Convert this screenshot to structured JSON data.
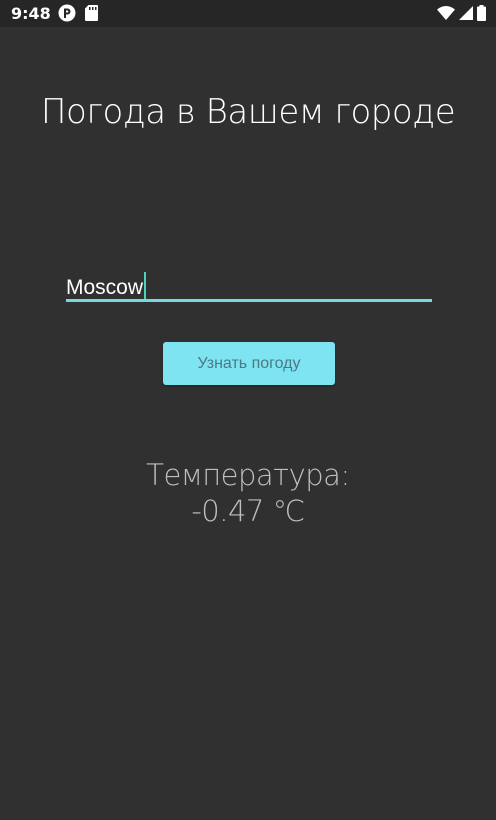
{
  "status_bar": {
    "time": "9:48",
    "left_icons": [
      "app-notification-icon",
      "sd-card-icon"
    ],
    "right_icons": [
      "wifi-icon",
      "cellular-signal-icon",
      "battery-icon"
    ]
  },
  "app": {
    "title": "Погода в Вашем городе",
    "city_input": {
      "value": "Moscow",
      "placeholder": ""
    },
    "get_weather_button_label": "Узнать погоду",
    "temperature_label": "Температура:",
    "temperature_value": "-0.47 ℃"
  },
  "colors": {
    "background": "#303030",
    "status_bar": "#262626",
    "accent": "#7ee4f1",
    "button_text": "#4a7a85",
    "caret": "#4dd0c0"
  }
}
